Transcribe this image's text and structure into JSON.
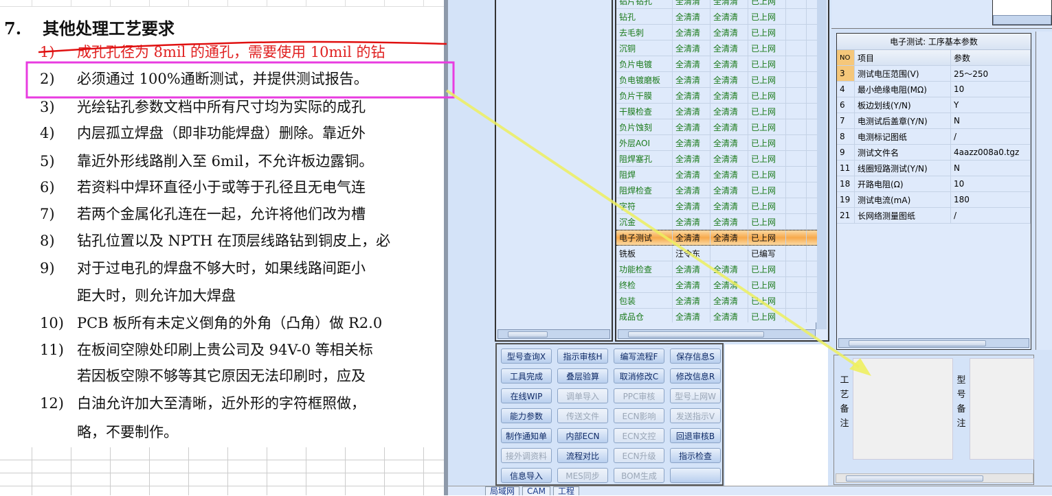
{
  "document": {
    "heading_num": "7.",
    "heading": "其他处理工艺要求",
    "items": [
      {
        "n": "1)",
        "t": "成孔孔径为 8mil 的通孔，需要使用 10mil 的钻",
        "struck": true
      },
      {
        "n": "2)",
        "t": "必须通过 100%通断测试，并提供测试报告。"
      },
      {
        "n": "3)",
        "t": "光绘钻孔参数文档中所有尺寸均为实际的成孔"
      },
      {
        "n": "4)",
        "t": "内层孤立焊盘（即非功能焊盘）删除。靠近外"
      },
      {
        "n": "5)",
        "t": "靠近外形线路削入至 6mil，不允许板边露铜。"
      },
      {
        "n": "6)",
        "t": "若资料中焊环直径小于或等于孔径且无电气连"
      },
      {
        "n": "7)",
        "t": "若两个金属化孔连在一起，允许将他们改为槽"
      },
      {
        "n": "8)",
        "t": "钻孔位置以及 NPTH 在顶层线路钻到铜皮上，必"
      },
      {
        "n": "9)",
        "t": "对于过电孔的焊盘不够大时，如果线路间距小",
        "c": "距大时，则允许加大焊盘"
      },
      {
        "n": "10)",
        "t": "PCB 板所有未定义倒角的外角（凸角）做 R2.0"
      },
      {
        "n": "11)",
        "t": "在板间空隙处印刷上贵公司及 94V-0 等相关标",
        "c": "若因板空隙不够等其它原因无法印刷时，应及"
      },
      {
        "n": "12)",
        "t": "白油允许加大至清晰，近外形的字符框照做，",
        "c": "略，不要制作。"
      }
    ]
  },
  "process_grid": {
    "rows": [
      [
        "铝片钻孔",
        "全清清",
        "全清清",
        "已上网"
      ],
      [
        "钻孔",
        "全清清",
        "全清清",
        "已上网"
      ],
      [
        "去毛刺",
        "全清清",
        "全清清",
        "已上网"
      ],
      [
        "沉铜",
        "全清清",
        "全清清",
        "已上网"
      ],
      [
        "负片电镀",
        "全清清",
        "全清清",
        "已上网"
      ],
      [
        "负电镀磨板",
        "全清清",
        "全清清",
        "已上网"
      ],
      [
        "负片干膜",
        "全清清",
        "全清清",
        "已上网"
      ],
      [
        "干膜检查",
        "全清清",
        "全清清",
        "已上网"
      ],
      [
        "负片蚀刻",
        "全清清",
        "全清清",
        "已上网"
      ],
      [
        "外层AOI",
        "全清清",
        "全清清",
        "已上网"
      ],
      [
        "阻焊塞孔",
        "全清清",
        "全清清",
        "已上网"
      ],
      [
        "阻焊",
        "全清清",
        "全清清",
        "已上网"
      ],
      [
        "阻焊检查",
        "全清清",
        "全清清",
        "已上网"
      ],
      [
        "字符",
        "全清清",
        "全清清",
        "已上网"
      ],
      [
        "沉金",
        "全清清",
        "全清清",
        "已上网"
      ],
      [
        "电子测试",
        "全清清",
        "全清清",
        "已上网"
      ],
      [
        "铣板",
        "汪令东",
        "",
        "已编写"
      ],
      [
        "功能检查",
        "全清清",
        "全清清",
        "已上网"
      ],
      [
        "终检",
        "全清清",
        "全清清",
        "已上网"
      ],
      [
        "包装",
        "全清清",
        "全清清",
        "已上网"
      ],
      [
        "成品仓",
        "全清清",
        "全清清",
        "已上网"
      ]
    ],
    "selected": "电子测试"
  },
  "buttons": [
    {
      "l": "型号查询X"
    },
    {
      "l": "指示审核H"
    },
    {
      "l": "编写流程F"
    },
    {
      "l": "保存信息S"
    },
    {
      "l": "工具完成"
    },
    {
      "l": "叠层验算"
    },
    {
      "l": "取消修改C"
    },
    {
      "l": "修改信息R"
    },
    {
      "l": "在线WIP"
    },
    {
      "l": "调单导入",
      "d": true
    },
    {
      "l": "PPC审核",
      "d": true
    },
    {
      "l": "型号上网W",
      "d": true
    },
    {
      "l": "能力参数"
    },
    {
      "l": "传送文件",
      "d": true
    },
    {
      "l": "ECN影响",
      "d": true
    },
    {
      "l": "发送指示V",
      "d": true
    },
    {
      "l": "制作通知单"
    },
    {
      "l": "内部ECN"
    },
    {
      "l": "ECN文控",
      "d": true
    },
    {
      "l": "回退审核B"
    },
    {
      "l": "接外调资料",
      "d": true
    },
    {
      "l": "流程对比"
    },
    {
      "l": "ECN升级",
      "d": true
    },
    {
      "l": "指示检查"
    },
    {
      "l": "信息导入"
    },
    {
      "l": "MES同步",
      "d": true
    },
    {
      "l": "BOM生成",
      "d": true
    },
    {
      "l": ""
    }
  ],
  "params": {
    "title": "电子测试: 工序基本参数",
    "headers": [
      "NO",
      "项目",
      "参数"
    ],
    "rows": [
      [
        "3",
        "测试电压范围(V)",
        "25～250"
      ],
      [
        "4",
        "最小绝缘电阻(MΩ)",
        "10"
      ],
      [
        "6",
        "板边划线(Y/N)",
        "Y"
      ],
      [
        "7",
        "电测试后盖章(Y/N)",
        "N"
      ],
      [
        "8",
        "电测标记图纸",
        "/"
      ],
      [
        "9",
        "测试文件名",
        "4aazz008a0.tgz"
      ],
      [
        "11",
        "线圈短路测试(Y/N)",
        "N"
      ],
      [
        "18",
        "开路电阻(Ω)",
        "10"
      ],
      [
        "19",
        "测试电流(mA)",
        "180"
      ],
      [
        "21",
        "长网络测量图纸",
        "/"
      ]
    ]
  },
  "notes": {
    "process_label": "工艺备注",
    "model_label": "型号备注"
  },
  "tabs": [
    "局域网",
    "CAM",
    "工程"
  ],
  "colors": {
    "annotation_box": "#e83ce0",
    "arrow": "#eef060",
    "strike": "#e01010",
    "selected_row": "#f7a94b",
    "status_green": "#1a7a1a"
  }
}
